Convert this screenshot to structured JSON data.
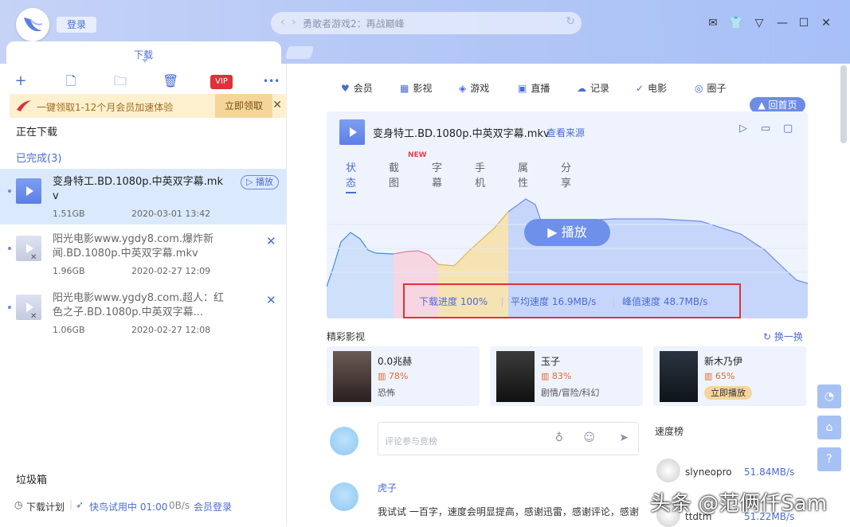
{
  "header": {
    "login": "登录",
    "address": "勇敢者游戏2：再战巅峰",
    "win_ctrls": [
      "✉",
      "👕",
      "▽",
      "—",
      "☐",
      "✕"
    ]
  },
  "left": {
    "tab": "下载",
    "toolbar": [
      "+",
      "🗋",
      "🗀",
      "🗑",
      "VIP",
      "•••"
    ],
    "promo": {
      "text": "一键领取1-12个月会员加速体验",
      "button": "立即领取",
      "close": "✕"
    },
    "downloading": "正在下载",
    "completed": "已完成(3)",
    "items": [
      {
        "name": "变身特工.BD.1080p.中英双字幕.mkv",
        "size": "1.51GB",
        "date": "2020-03-01 13:42",
        "action": "▷ 播放"
      },
      {
        "name": "阳光电影www.ygdy8.com.爆炸新闻.BD.1080p.中英双字幕.mkv",
        "size": "1.96GB",
        "date": "2020-02-27 12:09",
        "action": "✕"
      },
      {
        "name": "阳光电影www.ygdy8.com.超人：红色之子.BD.1080p.中英双字幕...",
        "size": "1.06GB",
        "date": "2020-02-27 12:08",
        "action": "✕"
      }
    ],
    "trash": "垃圾箱",
    "footer": {
      "plan": "下载计划",
      "trial": "快鸟试用中 01:00",
      "speed": "0B/s",
      "member": "会员登录"
    }
  },
  "right": {
    "nav": [
      {
        "icon": "♥",
        "label": "会员"
      },
      {
        "icon": "▦",
        "label": "影视"
      },
      {
        "icon": "◈",
        "label": "游戏"
      },
      {
        "icon": "▣",
        "label": "直播"
      },
      {
        "icon": "☁",
        "label": "记录"
      },
      {
        "icon": "✓",
        "label": "电影"
      },
      {
        "icon": "◎",
        "label": "圈子"
      }
    ],
    "home": "▲ 回首页",
    "file": {
      "name": "变身特工.BD.1080p.中英双字幕.mkv",
      "source": "查看来源"
    },
    "tabs": [
      "状态",
      "截图",
      "字幕",
      "手机",
      "属性",
      "分享"
    ],
    "new_badge": "NEW",
    "play": "▶ 播放",
    "stats": {
      "progress": "下载进度 100%",
      "avg": "平均速度 16.9MB/s",
      "peak": "峰值速度 48.7MB/s"
    },
    "featured_title": "精彩影视",
    "refresh": "换一换",
    "movies": [
      {
        "title": "0.0兆赫",
        "rate": "78%",
        "genre": "恐怖"
      },
      {
        "title": "玉子",
        "rate": "83%",
        "genre": "剧情/冒险/科幻"
      },
      {
        "title": "新木乃伊",
        "rate": "65%",
        "button": "立即播放"
      }
    ],
    "comment_ph": "评论参与竞榜",
    "speed_rank": "速度榜",
    "rank": [
      {
        "name": "slyneopro",
        "speed": "51.84MB/s"
      },
      {
        "name": "ttdtm",
        "speed": "51.22MB/s"
      }
    ],
    "comment_user": "虎子",
    "comment_text": "我试试 一百字，速度会明显提高，感谢迅雷，感谢评论，感谢"
  },
  "watermark": "头条 @范俩仟Sam"
}
